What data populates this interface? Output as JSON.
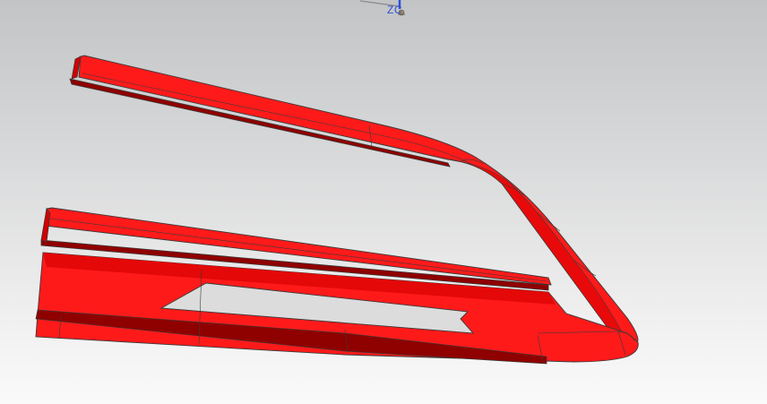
{
  "viewport": {
    "background_top": "#c2c4c6",
    "background_bottom": "#fafafa"
  },
  "triad": {
    "axis_label": "ZC",
    "label_color": "#2f4fd8",
    "icon": "coordinate-triad-icon"
  },
  "model": {
    "body_color": "#ff1a1a",
    "shade_color": "#d40000",
    "dark_color": "#8f0000",
    "edge_color": "#3a3a3a"
  }
}
